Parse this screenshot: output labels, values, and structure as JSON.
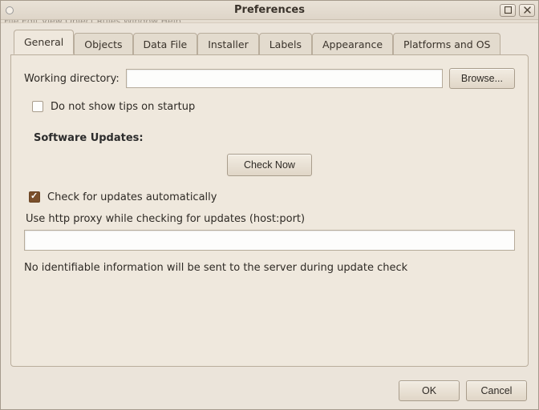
{
  "window": {
    "title": "Preferences"
  },
  "menubar_ghost": "File   Edit   View   Object   Rules   Window   Help",
  "tabs": [
    {
      "label": "General",
      "active": true
    },
    {
      "label": "Objects"
    },
    {
      "label": "Data File"
    },
    {
      "label": "Installer"
    },
    {
      "label": "Labels"
    },
    {
      "label": "Appearance"
    },
    {
      "label": "Platforms and OS"
    }
  ],
  "general": {
    "workdir_label": "Working directory:",
    "workdir_value": "",
    "browse_label": "Browse...",
    "no_tips_label": "Do not show tips on startup",
    "no_tips_checked": false,
    "updates_title": "Software Updates:",
    "check_now_label": "Check Now",
    "auto_check_label": "Check for updates automatically",
    "auto_check_checked": true,
    "proxy_label": "Use http proxy while checking for updates  (host:port)",
    "proxy_value": "",
    "privacy_note": "No identifiable information will be sent to the server during update check"
  },
  "footer": {
    "ok_label": "OK",
    "cancel_label": "Cancel"
  }
}
